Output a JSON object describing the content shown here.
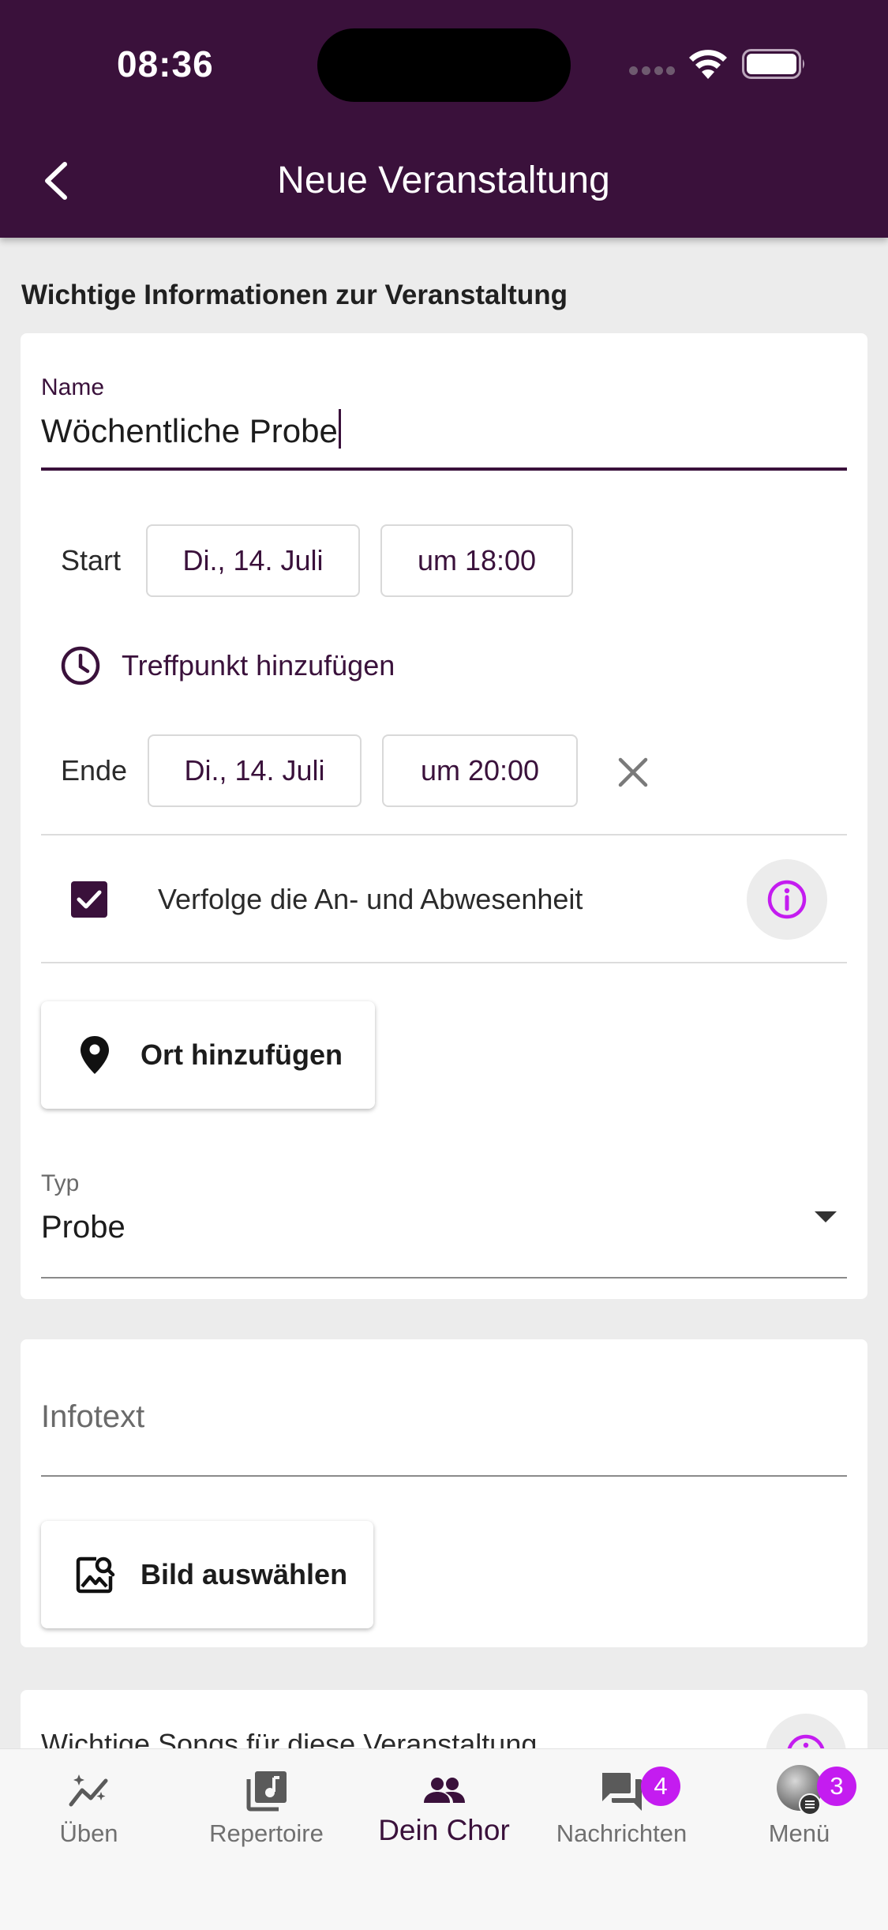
{
  "status_bar": {
    "time": "08:36"
  },
  "header": {
    "title": "Neue Veranstaltung"
  },
  "section": {
    "heading": "Wichtige Informationen zur Veranstaltung"
  },
  "form": {
    "name_label": "Name",
    "name_value": "Wöchentliche Probe",
    "start_label": "Start",
    "start_date": "Di., 14. Juli",
    "start_time": "um 18:00",
    "treffpunkt_label": "Treffpunkt hinzufügen",
    "end_label": "Ende",
    "end_date": "Di., 14. Juli",
    "end_time": "um 20:00",
    "attendance_label": "Verfolge die An- und Abwesenheit",
    "attendance_checked": true,
    "location_button": "Ort hinzufügen",
    "type_label": "Typ",
    "type_value": "Probe"
  },
  "info_card": {
    "infotext_placeholder": "Infotext",
    "image_button": "Bild auswählen"
  },
  "songs_card": {
    "label": "Wichtige Songs für diese Veranstaltung"
  },
  "colors": {
    "primary": "#3a113b",
    "accent": "#c41cf0"
  },
  "nav": {
    "items": [
      {
        "label": "Üben",
        "icon": "practice-icon"
      },
      {
        "label": "Repertoire",
        "icon": "music-library-icon"
      },
      {
        "label": "Dein Chor",
        "icon": "group-icon",
        "active": true
      },
      {
        "label": "Nachrichten",
        "icon": "chat-icon",
        "badge": "4"
      },
      {
        "label": "Menü",
        "icon": "avatar",
        "badge": "3"
      }
    ]
  }
}
